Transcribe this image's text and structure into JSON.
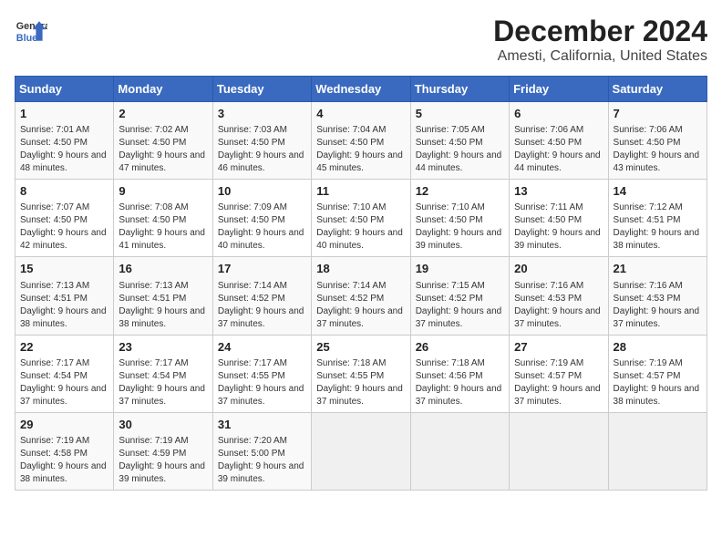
{
  "header": {
    "logo_line1": "General",
    "logo_line2": "Blue",
    "title": "December 2024",
    "subtitle": "Amesti, California, United States"
  },
  "days_of_week": [
    "Sunday",
    "Monday",
    "Tuesday",
    "Wednesday",
    "Thursday",
    "Friday",
    "Saturday"
  ],
  "weeks": [
    [
      {
        "day": "1",
        "rise": "7:01 AM",
        "set": "4:50 PM",
        "daylight": "9 hours and 48 minutes."
      },
      {
        "day": "2",
        "rise": "7:02 AM",
        "set": "4:50 PM",
        "daylight": "9 hours and 47 minutes."
      },
      {
        "day": "3",
        "rise": "7:03 AM",
        "set": "4:50 PM",
        "daylight": "9 hours and 46 minutes."
      },
      {
        "day": "4",
        "rise": "7:04 AM",
        "set": "4:50 PM",
        "daylight": "9 hours and 45 minutes."
      },
      {
        "day": "5",
        "rise": "7:05 AM",
        "set": "4:50 PM",
        "daylight": "9 hours and 44 minutes."
      },
      {
        "day": "6",
        "rise": "7:06 AM",
        "set": "4:50 PM",
        "daylight": "9 hours and 44 minutes."
      },
      {
        "day": "7",
        "rise": "7:06 AM",
        "set": "4:50 PM",
        "daylight": "9 hours and 43 minutes."
      }
    ],
    [
      {
        "day": "8",
        "rise": "7:07 AM",
        "set": "4:50 PM",
        "daylight": "9 hours and 42 minutes."
      },
      {
        "day": "9",
        "rise": "7:08 AM",
        "set": "4:50 PM",
        "daylight": "9 hours and 41 minutes."
      },
      {
        "day": "10",
        "rise": "7:09 AM",
        "set": "4:50 PM",
        "daylight": "9 hours and 40 minutes."
      },
      {
        "day": "11",
        "rise": "7:10 AM",
        "set": "4:50 PM",
        "daylight": "9 hours and 40 minutes."
      },
      {
        "day": "12",
        "rise": "7:10 AM",
        "set": "4:50 PM",
        "daylight": "9 hours and 39 minutes."
      },
      {
        "day": "13",
        "rise": "7:11 AM",
        "set": "4:50 PM",
        "daylight": "9 hours and 39 minutes."
      },
      {
        "day": "14",
        "rise": "7:12 AM",
        "set": "4:51 PM",
        "daylight": "9 hours and 38 minutes."
      }
    ],
    [
      {
        "day": "15",
        "rise": "7:13 AM",
        "set": "4:51 PM",
        "daylight": "9 hours and 38 minutes."
      },
      {
        "day": "16",
        "rise": "7:13 AM",
        "set": "4:51 PM",
        "daylight": "9 hours and 38 minutes."
      },
      {
        "day": "17",
        "rise": "7:14 AM",
        "set": "4:52 PM",
        "daylight": "9 hours and 37 minutes."
      },
      {
        "day": "18",
        "rise": "7:14 AM",
        "set": "4:52 PM",
        "daylight": "9 hours and 37 minutes."
      },
      {
        "day": "19",
        "rise": "7:15 AM",
        "set": "4:52 PM",
        "daylight": "9 hours and 37 minutes."
      },
      {
        "day": "20",
        "rise": "7:16 AM",
        "set": "4:53 PM",
        "daylight": "9 hours and 37 minutes."
      },
      {
        "day": "21",
        "rise": "7:16 AM",
        "set": "4:53 PM",
        "daylight": "9 hours and 37 minutes."
      }
    ],
    [
      {
        "day": "22",
        "rise": "7:17 AM",
        "set": "4:54 PM",
        "daylight": "9 hours and 37 minutes."
      },
      {
        "day": "23",
        "rise": "7:17 AM",
        "set": "4:54 PM",
        "daylight": "9 hours and 37 minutes."
      },
      {
        "day": "24",
        "rise": "7:17 AM",
        "set": "4:55 PM",
        "daylight": "9 hours and 37 minutes."
      },
      {
        "day": "25",
        "rise": "7:18 AM",
        "set": "4:55 PM",
        "daylight": "9 hours and 37 minutes."
      },
      {
        "day": "26",
        "rise": "7:18 AM",
        "set": "4:56 PM",
        "daylight": "9 hours and 37 minutes."
      },
      {
        "day": "27",
        "rise": "7:19 AM",
        "set": "4:57 PM",
        "daylight": "9 hours and 37 minutes."
      },
      {
        "day": "28",
        "rise": "7:19 AM",
        "set": "4:57 PM",
        "daylight": "9 hours and 38 minutes."
      }
    ],
    [
      {
        "day": "29",
        "rise": "7:19 AM",
        "set": "4:58 PM",
        "daylight": "9 hours and 38 minutes."
      },
      {
        "day": "30",
        "rise": "7:19 AM",
        "set": "4:59 PM",
        "daylight": "9 hours and 39 minutes."
      },
      {
        "day": "31",
        "rise": "7:20 AM",
        "set": "5:00 PM",
        "daylight": "9 hours and 39 minutes."
      },
      null,
      null,
      null,
      null
    ]
  ],
  "labels": {
    "sunrise": "Sunrise:",
    "sunset": "Sunset:",
    "daylight": "Daylight:"
  }
}
